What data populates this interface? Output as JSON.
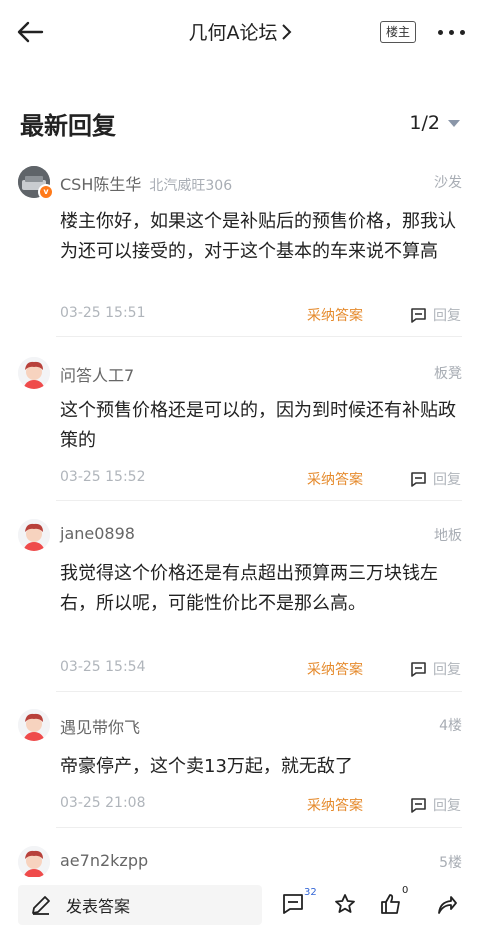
{
  "header": {
    "title": "几何A论坛",
    "owner_badge": "楼主"
  },
  "section": {
    "title": "最新回复",
    "pager": "1/2"
  },
  "posts": [
    {
      "user": "CSH陈生华",
      "user_sub": "北汽威旺306",
      "floor": "沙发",
      "content": "楼主你好，如果这个是补贴后的预售价格，那我认为还可以接受的，对于这个基本的车来说不算高",
      "time": "03-25 15:51",
      "accept": "采纳答案",
      "reply": "回复"
    },
    {
      "user": "问答人工7",
      "floor": "板凳",
      "content": "这个预售价格还是可以的，因为到时候还有补贴政策的",
      "time": "03-25 15:52",
      "accept": "采纳答案",
      "reply": "回复"
    },
    {
      "user": "jane0898",
      "floor": "地板",
      "content": "我觉得这个价格还是有点超出预算两三万块钱左右，所以呢，可能性价比不是那么高。",
      "time": "03-25 15:54",
      "accept": "采纳答案",
      "reply": "回复"
    },
    {
      "user": "遇见带你飞",
      "floor": "4楼",
      "content": "帝豪停产，这个卖13万起，就无敌了",
      "time": "03-25 21:08",
      "accept": "采纳答案",
      "reply": "回复"
    },
    {
      "user": "ae7n2kzpp",
      "floor": "5楼"
    }
  ],
  "bottom": {
    "compose_label": "发表答案",
    "comment_count": "32",
    "like_count": "0"
  },
  "colors": {
    "accent_orange": "#e58a2c",
    "count_blue": "#3567d6",
    "muted": "#b0b5bb"
  }
}
